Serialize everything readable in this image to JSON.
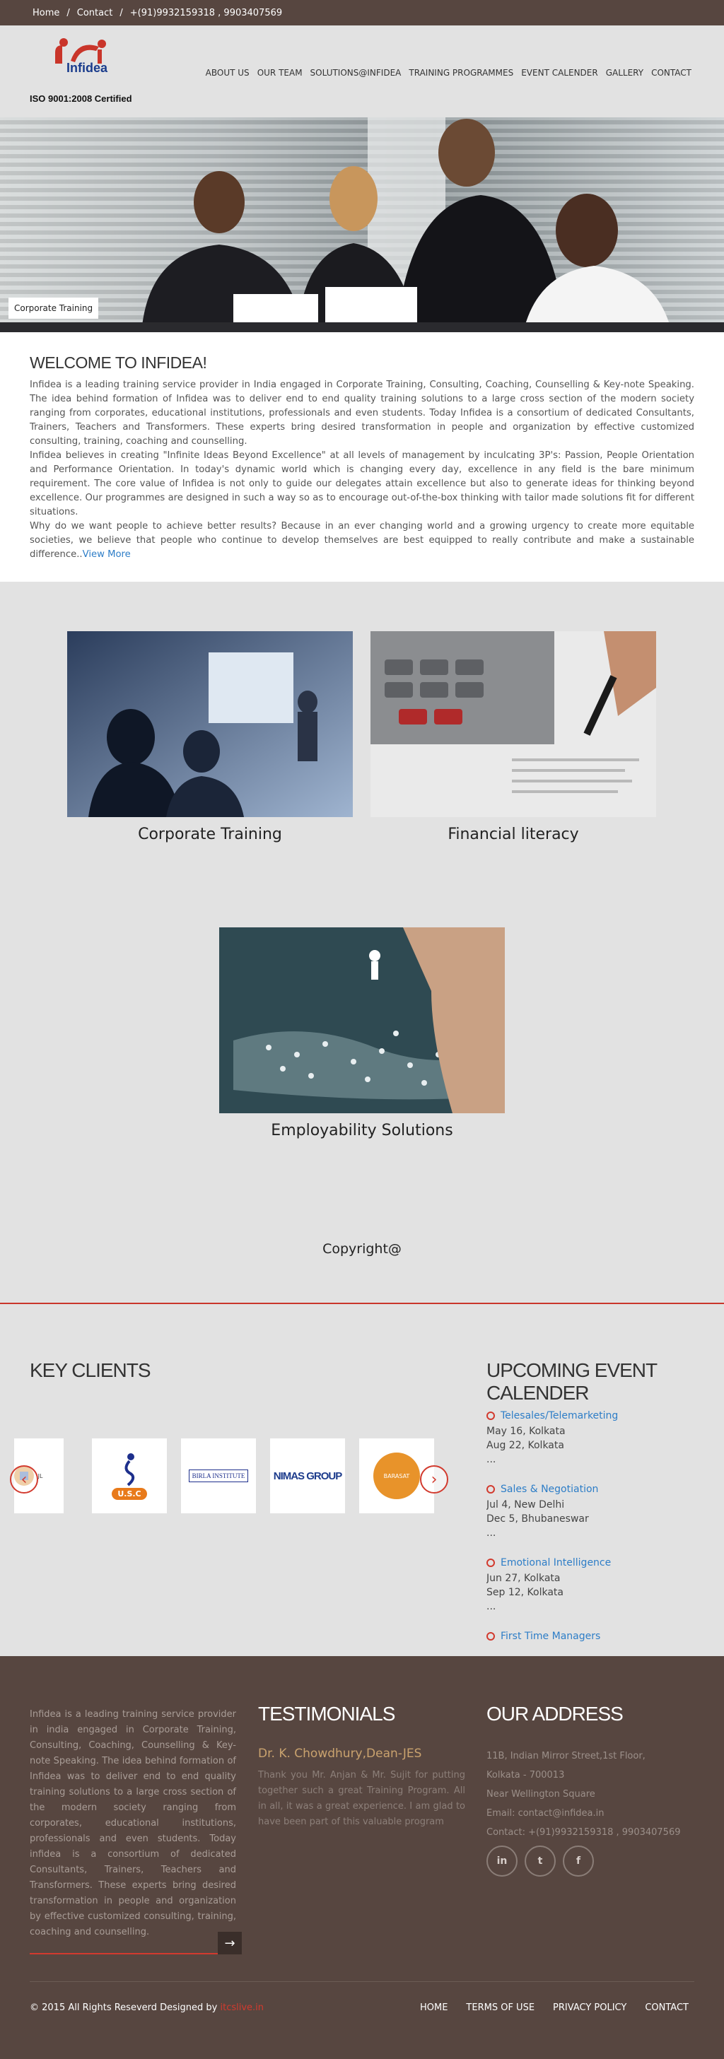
{
  "topbar": {
    "home": "Home",
    "sep1": "/",
    "contact": "Contact",
    "sep2": "/",
    "phone": "+(91)9932159318 , 9903407569"
  },
  "header": {
    "brand": "Infidea",
    "iso": "ISO 9001:2008 Certified"
  },
  "nav": [
    "ABOUT US",
    "OUR TEAM",
    "SOLUTIONS@INFIDEA",
    "TRAINING PROGRAMMES",
    "EVENT CALENDER",
    "GALLERY",
    "CONTACT"
  ],
  "hero": {
    "caption": "Corporate Training"
  },
  "welcome": {
    "title": "WELCOME TO INFIDEA!",
    "p1": "Infidea is a leading training service provider in India engaged in Corporate Training, Consulting, Coaching, Counselling & Key-note Speaking. The idea behind formation of Infidea was to deliver end to end quality training solutions to a large cross section of the modern society ranging from corporates, educational institutions, professionals and even students. Today Infidea is a consortium of dedicated Consultants, Trainers, Teachers and Transformers. These experts bring desired transformation in people and organization by effective customized consulting, training, coaching and counselling.",
    "p2": "Infidea believes in creating \"Infinite Ideas Beyond Excellence\" at all levels of management by inculcating 3P's: Passion, People Orientation and Performance Orientation. In today's dynamic world which is changing every day, excellence in any field is the bare minimum requirement. The core value of Infidea is not only to guide our delegates attain excellence but also to generate ideas for thinking beyond excellence. Our programmes are designed in such a way so as to encourage out-of-the-box thinking with tailor made solutions fit for different situations.",
    "p3": "Why do we want people to achieve better results? Because in an ever changing world and a growing urgency to create more equitable societies, we believe that people who continue to develop themselves are best equipped to really contribute and make a sustainable difference..",
    "more": "View More"
  },
  "services": [
    "Corporate Training",
    "Financial literacy",
    "Employability Solutions"
  ],
  "copyright": "Copyright@",
  "clients": {
    "title": "KEY CLIENTS",
    "logos": [
      "JL",
      "U.S.C",
      "BIRLA INSTITUTE",
      "NIMAS GROUP",
      "BARASAT"
    ],
    "prev": "‹",
    "next": "›"
  },
  "events": {
    "title": "UPCOMING EVENT CALENDER",
    "items": [
      {
        "name": "Telesales/Telemarketing",
        "d1": "May 16, Kolkata",
        "d2": "Aug 22, Kolkata",
        "more": "..."
      },
      {
        "name": "Sales & Negotiation",
        "d1": "Jul 4, New Delhi",
        "d2": "Dec 5, Bhubaneswar",
        "more": "..."
      },
      {
        "name": "Emotional Intelligence",
        "d1": "Jun 27, Kolkata",
        "d2": "Sep 12, Kolkata",
        "more": "..."
      },
      {
        "name": "First Time Managers",
        "d1": "",
        "d2": "",
        "more": ""
      }
    ]
  },
  "footer": {
    "about": "Infidea is a leading training service provider in india engaged in Corporate Training, Consulting, Coaching, Counselling & Key-note Speaking. The idea behind formation of Infidea was to deliver end to end quality training solutions to a large cross section of the modern society ranging from corporates, educational institutions, professionals and even students. Today infidea is a consortium of dedicated Consultants, Trainers, Teachers and Transformers. These experts bring desired transformation in people and organization by effective customized consulting, training, coaching and counselling.",
    "subscribe_arrow": "→",
    "testimonials_title": "TESTIMONIALS",
    "testimonial_author": "Dr. K. Chowdhury,Dean-JES",
    "testimonial_text": "Thank you Mr. Anjan & Mr. Sujit for putting together such a great Training Program. All in all, it was a great experience. I am glad to have been part of this valuable program",
    "address_title": "OUR ADDRESS",
    "address": [
      "11B, Indian Mirror Street,1st Floor,",
      "Kolkata - 700013",
      "Near Wellington Square",
      "Email: contact@infidea.in",
      "Contact: +(91)9932159318 , 9903407569"
    ],
    "social": [
      "in",
      "t",
      "f"
    ],
    "copy_prefix": "© 2015 All Rights Reseverd Designed by",
    "copy_link": "itcslive.in",
    "nav": [
      "HOME",
      "TERMS OF USE",
      "PRIVACY POLICY",
      "CONTACT"
    ]
  }
}
